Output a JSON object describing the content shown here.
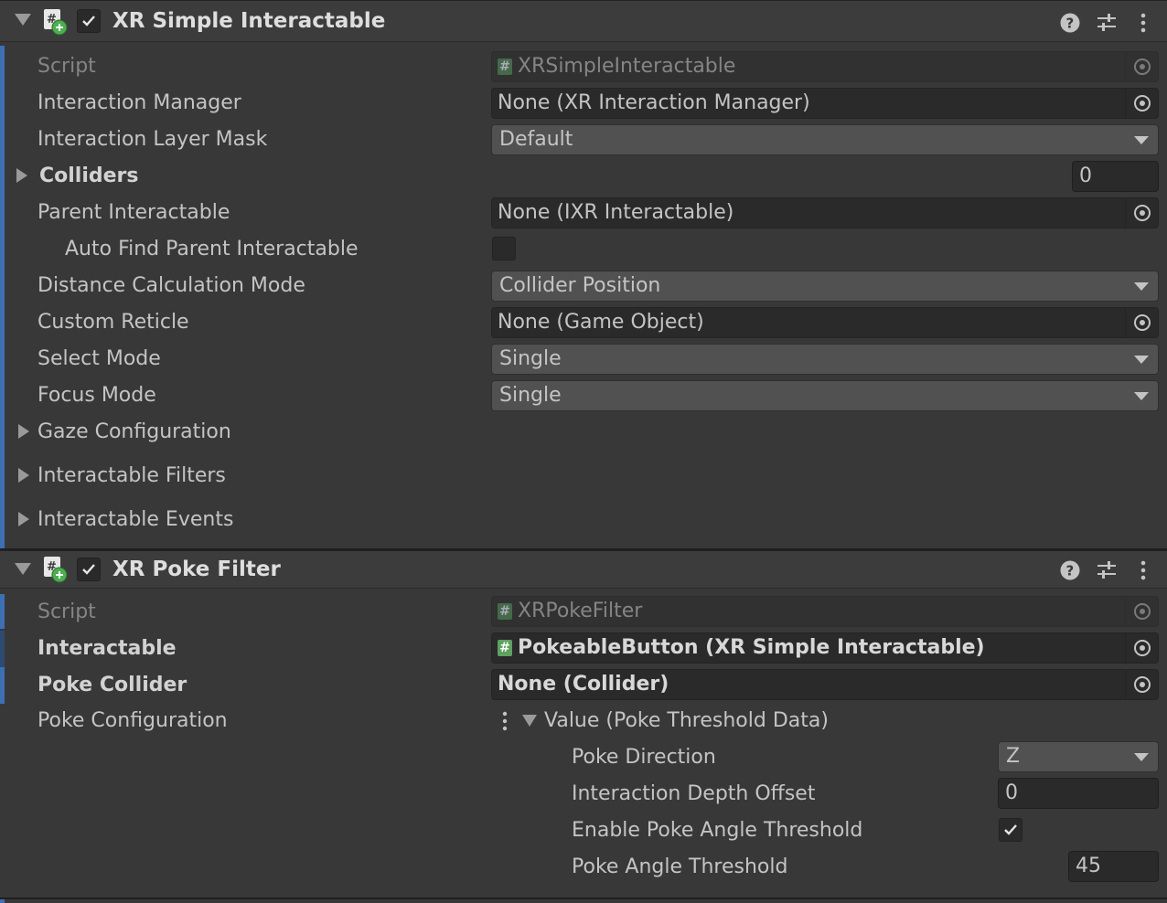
{
  "components": [
    {
      "title": "XR Simple Interactable",
      "enabled": true,
      "header_icons": [
        "help-icon",
        "preset-icon",
        "kebab-menu-icon"
      ],
      "fields": {
        "script_label": "Script",
        "script_value": "XRSimpleInteractable",
        "interaction_manager_label": "Interaction Manager",
        "interaction_manager_value": "None (XR Interaction Manager)",
        "layer_mask_label": "Interaction Layer Mask",
        "layer_mask_value": "Default",
        "colliders_label": "Colliders",
        "colliders_count": "0",
        "parent_label": "Parent Interactable",
        "parent_value": "None (IXR Interactable)",
        "auto_find_label": "Auto Find Parent Interactable",
        "distance_label": "Distance Calculation Mode",
        "distance_value": "Collider Position",
        "reticle_label": "Custom Reticle",
        "reticle_value": "None (Game Object)",
        "select_label": "Select Mode",
        "select_value": "Single",
        "focus_label": "Focus Mode",
        "focus_value": "Single",
        "gaze_label": "Gaze Configuration",
        "filters_label": "Interactable Filters",
        "events_label": "Interactable Events"
      }
    },
    {
      "title": "XR Poke Filter",
      "enabled": true,
      "header_icons": [
        "help-icon",
        "preset-icon",
        "kebab-menu-icon"
      ],
      "fields": {
        "script_label": "Script",
        "script_value": "XRPokeFilter",
        "interactable_label": "Interactable",
        "interactable_value": "PokeableButton (XR Simple Interactable)",
        "poke_collider_label": "Poke Collider",
        "poke_collider_value": "None (Collider)",
        "poke_config_label": "Poke Configuration",
        "value_label": "Value (Poke Threshold Data)",
        "poke_direction_label": "Poke Direction",
        "poke_direction_value": "Z",
        "depth_offset_label": "Interaction Depth Offset",
        "depth_offset_value": "0",
        "enable_angle_label": "Enable Poke Angle Threshold",
        "enable_angle_checked": true,
        "angle_label": "Poke Angle Threshold",
        "angle_value": "45"
      }
    }
  ],
  "colors": {
    "panel": "#383838",
    "header": "#3c3c3c",
    "accent_bar": "#3d6fb5",
    "field_dark": "#2a2a2a",
    "dropdown": "#515151",
    "script_icon_green": "#5fa160"
  }
}
